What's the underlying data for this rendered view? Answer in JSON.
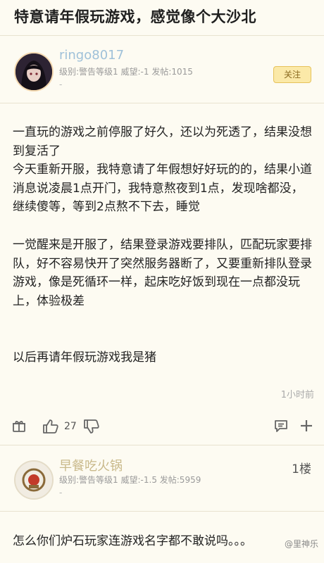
{
  "post": {
    "title": "特意请年假玩游戏，感觉像个大沙北",
    "author": {
      "name": "ringo8017",
      "meta": "级别:警告等级1 威望:-1 发帖:1015",
      "sub": "-"
    },
    "follow_label": "关注",
    "paragraphs": [
      "一直玩的游戏之前停服了好久，还以为死透了，结果没想到复活了",
      "今天重新开服，我特意请了年假想好好玩的的，结果小道消息说凌晨1点开门，我特意熬夜到1点，发现啥都没，继续傻等，等到2点熬不下去，睡觉",
      "一觉醒来是开服了，结果登录游戏要排队，匹配玩家要排队，好不容易快开了突然服务器断了，又要重新排队登录游戏，像是死循环一样，起床吃好饭到现在一点都没玩上，体验极差",
      "以后再请年假玩游戏我是猪"
    ],
    "time": "1小时前",
    "like_count": "27"
  },
  "reply": {
    "author": {
      "name": "早餐吃火锅",
      "meta": "级别:警告等级1 威望:-1.5 发帖:5959",
      "sub": "-"
    },
    "floor": "1楼",
    "text": "怎么你们炉石玩家连游戏名字都不敢说吗。。。"
  },
  "watermark": "@里神乐",
  "icons": {
    "gift": "gift-icon",
    "like": "thumbs-up-icon",
    "dislike": "thumbs-down-icon",
    "comment": "comment-icon",
    "more": "plus-icon"
  },
  "colors": {
    "background": "#fdfbf2",
    "username": "#9fc1d9",
    "follow_bg": "#fbe9a8"
  }
}
